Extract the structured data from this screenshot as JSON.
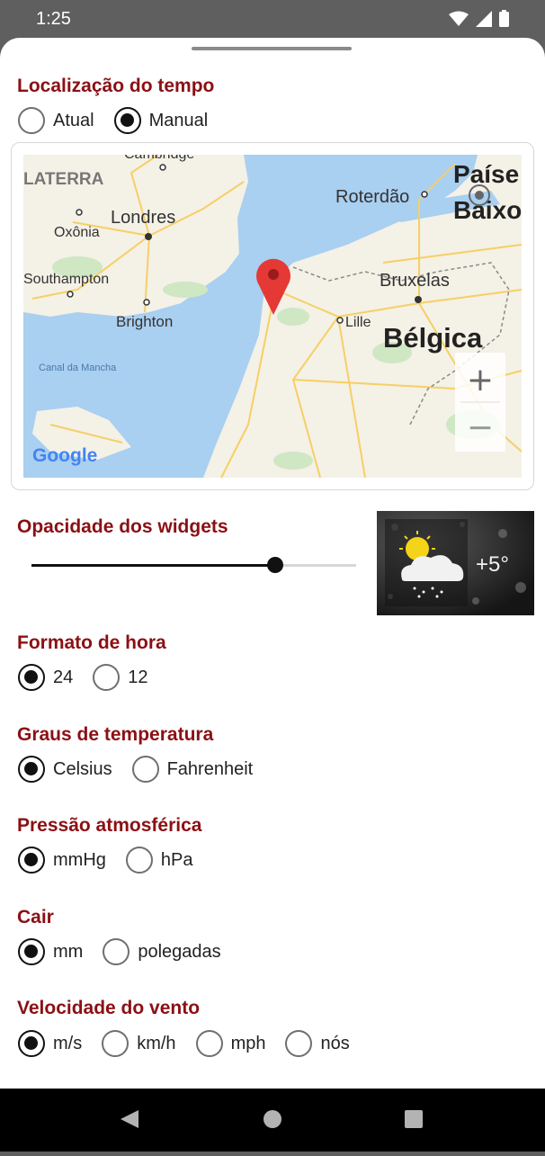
{
  "status_bar": {
    "time": "1:25"
  },
  "location": {
    "title": "Localização do tempo",
    "options": [
      "Atual",
      "Manual"
    ],
    "selected": 1,
    "map_labels": {
      "england_partial": "LATERRA",
      "cambridge_partial": "Cambridge",
      "london": "Londres",
      "oxford": "Oxônia",
      "southampton": "Southampton",
      "brighton": "Brighton",
      "channel": "Canal da Mancha",
      "rotterdam": "Roterdão",
      "netherlands_line1": "Paíse",
      "netherlands_line2": "Baixo",
      "brussels": "Bruxelas",
      "lille": "Lille",
      "belgium": "Bélgica",
      "google": "Google",
      "zoom_in": "+",
      "zoom_out": "−"
    }
  },
  "opacity": {
    "title": "Opacidade dos widgets",
    "value_fraction": 0.75,
    "preview_temp": "+5°"
  },
  "time_format": {
    "title": "Formato de hora",
    "options": [
      "24",
      "12"
    ],
    "selected": 0
  },
  "temperature": {
    "title": "Graus de temperatura",
    "options": [
      "Celsius",
      "Fahrenheit"
    ],
    "selected": 0
  },
  "pressure": {
    "title": "Pressão atmosférica",
    "options": [
      "mmHg",
      "hPa"
    ],
    "selected": 0
  },
  "precipitation": {
    "title": "Cair",
    "options": [
      "mm",
      "polegadas"
    ],
    "selected": 0
  },
  "wind_speed": {
    "title": "Velocidade do vento",
    "options": [
      "m/s",
      "km/h",
      "mph",
      "nós"
    ],
    "selected": 0
  },
  "colors": {
    "accent": "#8b1014",
    "water": "#a9cff1",
    "land": "#f4f1e6",
    "marker": "#e53935"
  },
  "icons": [
    "wifi-icon",
    "signal-icon",
    "battery-icon",
    "my-location-icon",
    "map-pin-icon",
    "sun-icon",
    "cloud-icon",
    "back-icon",
    "home-icon",
    "recents-icon"
  ]
}
